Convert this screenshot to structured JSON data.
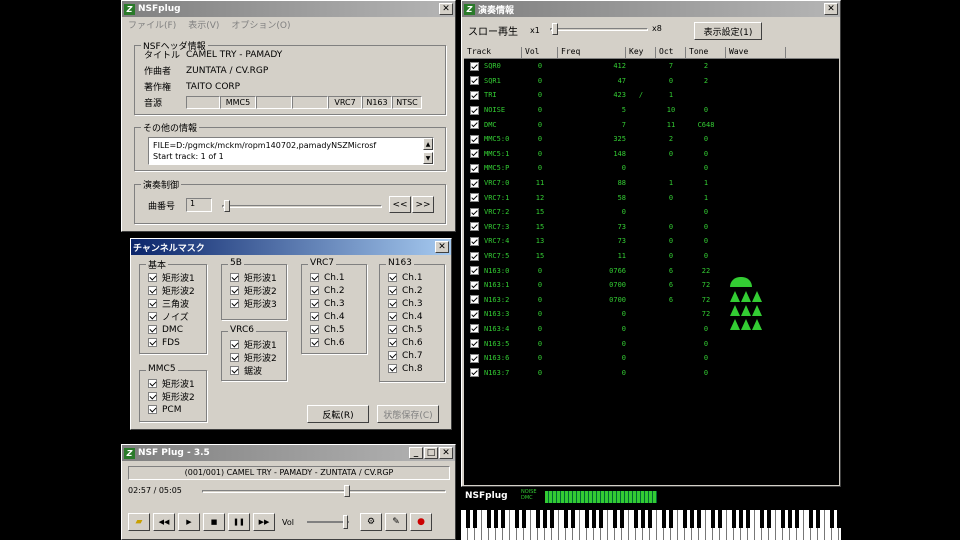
{
  "main": {
    "title": "NSFplug",
    "menu": [
      "ファイル(F)",
      "表示(V)",
      "オプション(O)"
    ],
    "nsf_header": {
      "label": "NSFヘッダ情報",
      "title_label": "タイトル",
      "title": "CAMEL TRY - PAMADY",
      "artist_label": "作曲者",
      "artist": "ZUNTATA / CV.RGP",
      "copyright_label": "著作権",
      "copyright": "TAITO CORP",
      "sound_label": "音源",
      "chips": [
        "",
        "MMC5",
        "",
        "",
        "VRC7",
        "N163",
        "NTSC"
      ]
    },
    "other_info": {
      "label": "その他の情報",
      "line1": "FILE=D:/pgmck/mckm/ropm140702,pamadyNSZMicrosf",
      "line2": "Start track: 1 of 1"
    },
    "playback": {
      "label": "演奏制御",
      "track_label": "曲番号",
      "track_value": "1",
      "prev": "<<",
      "next": ">>"
    }
  },
  "mask": {
    "title": "チャンネルマスク",
    "groups": [
      {
        "name": "基本",
        "items": [
          "矩形波1",
          "矩形波2",
          "三角波",
          "ノイズ",
          "DMC",
          "FDS"
        ]
      },
      {
        "name": "5B",
        "items": [
          "矩形波1",
          "矩形波2",
          "矩形波3"
        ]
      },
      {
        "name": "VRC7",
        "items": [
          "Ch.1",
          "Ch.2",
          "Ch.3",
          "Ch.4",
          "Ch.5",
          "Ch.6"
        ]
      },
      {
        "name": "N163",
        "items": [
          "Ch.1",
          "Ch.2",
          "Ch.3",
          "Ch.4",
          "Ch.5",
          "Ch.6",
          "Ch.7",
          "Ch.8"
        ]
      },
      {
        "name": "VRC6",
        "items": [
          "矩形波1",
          "矩形波2",
          "鋸波"
        ]
      },
      {
        "name": "MMC5",
        "items": [
          "矩形波1",
          "矩形波2",
          "PCM"
        ]
      }
    ],
    "invert_button": "反転(R)",
    "reset_button": "状態保存(C)"
  },
  "player": {
    "title": "NSF Plug - 3.5",
    "now_playing": "(001/001) CAMEL TRY - PAMADY - ZUNTATA / CV.RGP",
    "time": "02:57 / 05:05",
    "position": 0.58,
    "vol_label": "Vol"
  },
  "info": {
    "title": "演奏情報",
    "slow_label": "スロー再生",
    "slow_min": "x1",
    "slow_max": "x8",
    "display_button": "表示設定(1)",
    "columns": [
      "Track",
      "Vol",
      "Freq",
      "Key",
      "Oct",
      "Tone",
      "Wave"
    ],
    "rows": [
      [
        "SQR0",
        "0",
        "412",
        "",
        "7",
        "2"
      ],
      [
        "SQR1",
        "0",
        "47",
        "",
        "0",
        "2"
      ],
      [
        "TRI",
        "0",
        "423",
        "/",
        "1",
        ""
      ],
      [
        "NOISE",
        "0",
        "5",
        "",
        "10",
        "0"
      ],
      [
        "DMC",
        "0",
        "7",
        "",
        "11",
        "C648"
      ],
      [
        "MMC5:0",
        "0",
        "325",
        "",
        "2",
        "0"
      ],
      [
        "MMC5:1",
        "0",
        "148",
        "",
        "0",
        "0"
      ],
      [
        "MMC5:P",
        "0",
        "0",
        "",
        "",
        "0"
      ],
      [
        "VRC7:0",
        "11",
        "88",
        "",
        "1",
        "1"
      ],
      [
        "VRC7:1",
        "12",
        "58",
        "",
        "0",
        "1"
      ],
      [
        "VRC7:2",
        "15",
        "0",
        "",
        "",
        "0"
      ],
      [
        "VRC7:3",
        "15",
        "73",
        "",
        "0",
        "0"
      ],
      [
        "VRC7:4",
        "13",
        "73",
        "",
        "0",
        "0"
      ],
      [
        "VRC7:5",
        "15",
        "11",
        "",
        "0",
        "0"
      ],
      [
        "N163:0",
        "0",
        "0766",
        "",
        "6",
        "22"
      ],
      [
        "N163:1",
        "0",
        "0700",
        "",
        "6",
        "72"
      ],
      [
        "N163:2",
        "0",
        "0700",
        "",
        "6",
        "72"
      ],
      [
        "N163:3",
        "0",
        "0",
        "",
        "",
        "72"
      ],
      [
        "N163:4",
        "0",
        "0",
        "",
        "",
        "0"
      ],
      [
        "N163:5",
        "0",
        "0",
        "",
        "",
        "0"
      ],
      [
        "N163:6",
        "0",
        "0",
        "",
        "",
        "0"
      ],
      [
        "N163:7",
        "0",
        "0",
        "",
        "",
        "0"
      ]
    ],
    "bar_logo": "NSFplug",
    "meter_labels": [
      "NOISE",
      "DMC"
    ]
  }
}
